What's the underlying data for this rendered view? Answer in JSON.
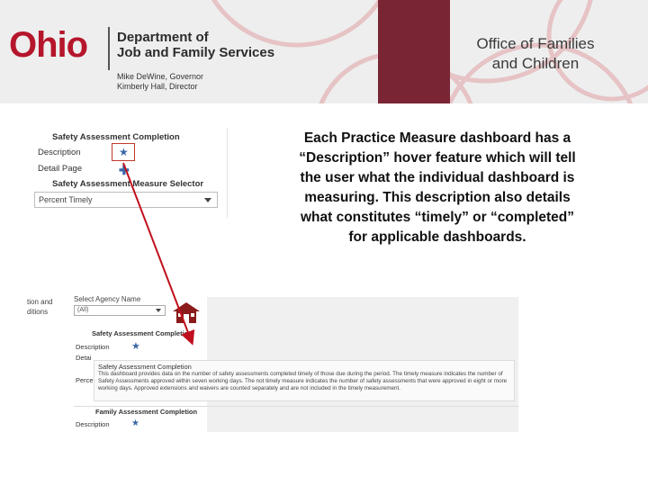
{
  "header": {
    "logo_o": "O",
    "logo_rest": "hio",
    "department_line1": "Department of",
    "department_line2": "Job and Family Services",
    "governor": "Mike DeWine, Governor",
    "director": "Kimberly Hall, Director",
    "office_line1": "Office of Families",
    "office_line2": "and Children",
    "colors": {
      "ohio_red": "#b5162b",
      "maroon_band": "#7a2534",
      "banner_bg": "#eeeeee"
    }
  },
  "description": "Each Practice Measure dashboard has a “Description” hover feature which will tell the user what the individual dashboard is measuring. This description also details what constitutes “timely” or “completed” for applicable dashboards.",
  "top_panel": {
    "title": "Safety Assessment Completion",
    "description_label": "Description",
    "detail_page_label": "Detail Page",
    "selector_title": "Safety Assessment Measure Selector",
    "selector_value": "Percent Timely",
    "star_icon": "star-icon",
    "plus_icon": "plus-icon"
  },
  "bottom_panel": {
    "left_label_line1": "tion and",
    "left_label_line2": "ditions",
    "agency_label": "Select Agency Name",
    "agency_value": "(All)",
    "sac_title": "Safety Assessment Completion",
    "description_label": "Description",
    "peek_detail": "Detai",
    "peek_perc": "Perce",
    "tooltip_title": "Safety Assessment Completion",
    "tooltip_body": "This dashboard provides data on the number of safety assessments completed timely of those due during the period. The timely measure indicates the number of Safety Assessments approved within seven working days. The not timely measure indicates the number of safety assessments that were approved in eight or more working days. Approved extensions and waivers are counted separately and are not included in the timely measurement.",
    "family_title": "Family Assessment Completion",
    "description2_label": "Description",
    "home_icon": "house-icon"
  },
  "arrow_color": "#c0101e"
}
